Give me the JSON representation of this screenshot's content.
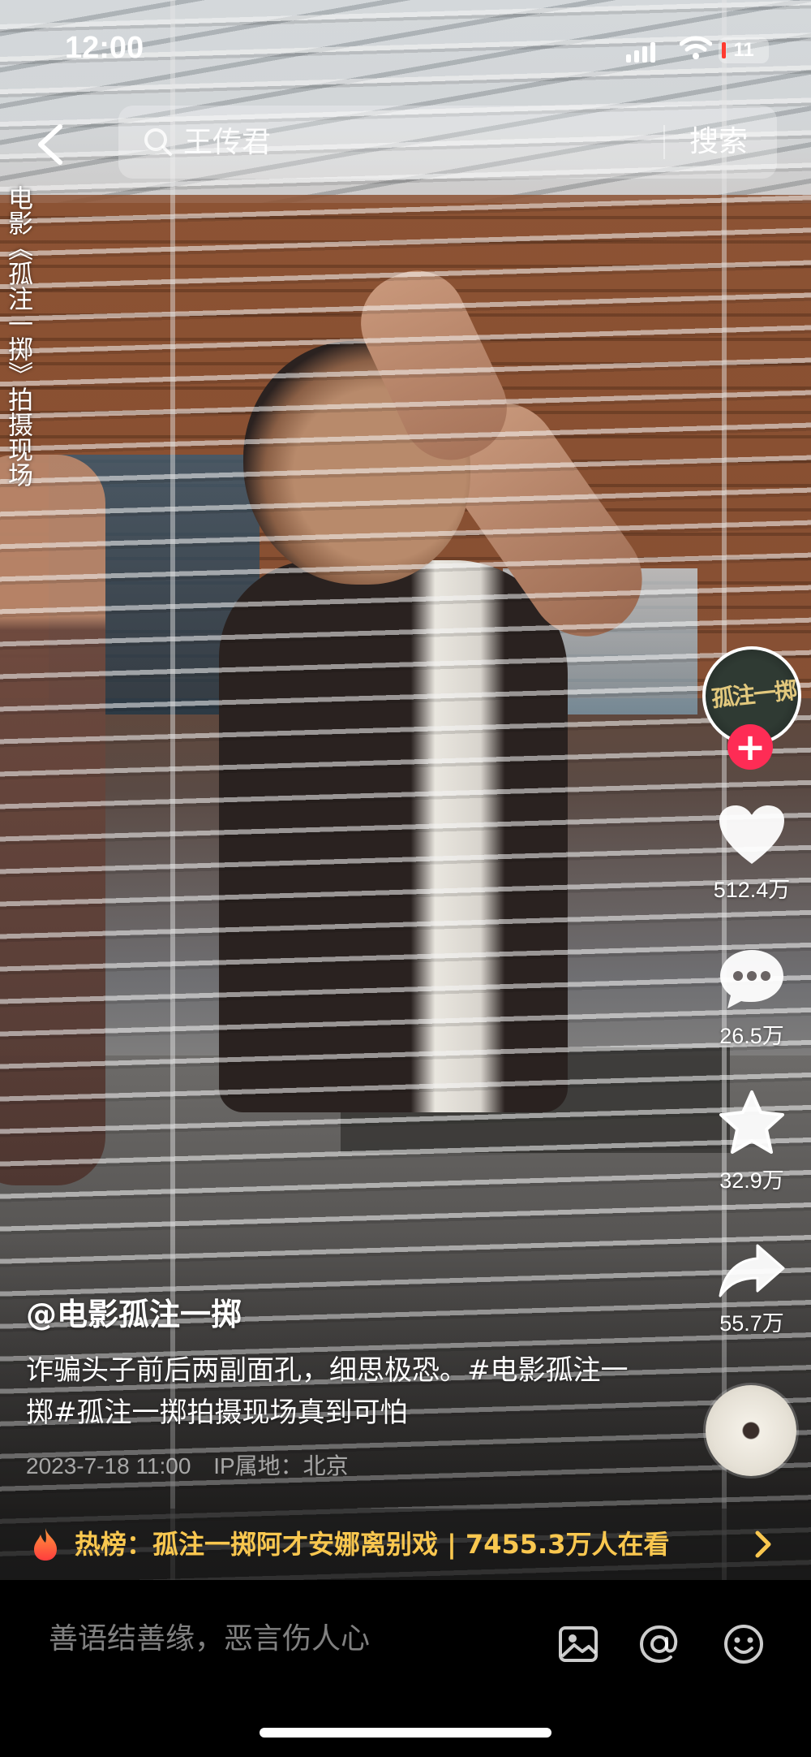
{
  "status_bar": {
    "time": "12:00",
    "battery": "11"
  },
  "search": {
    "placeholder": "王传君",
    "button_label": "搜索"
  },
  "side_label": "电影《孤注一掷》拍摄现场",
  "account": {
    "avatar_text": "孤注一掷",
    "follow_symbol": "+"
  },
  "actions": {
    "like_count": "512.4万",
    "comment_count": "26.5万",
    "favorite_count": "32.9万",
    "share_count": "55.7万"
  },
  "post": {
    "author": "@电影孤注一掷",
    "description": "诈骗头子前后两副面孔，细思极恐。#电影孤注一掷#孤注一掷拍摄现场真到可怕",
    "date": "2023-7-18 11:00",
    "ip_location": "IP属地：北京"
  },
  "hot_banner": {
    "text": "热榜：孤注一掷阿才安娜离别戏 | 7455.3万人在看"
  },
  "comment_bar": {
    "placeholder": "善语结善缘，恶言伤人心"
  },
  "icons": [
    "back-icon",
    "search-icon",
    "heart-icon",
    "comment-icon",
    "star-icon",
    "share-icon",
    "fire-icon",
    "chevron-right-icon",
    "image-icon",
    "at-icon",
    "emoji-icon",
    "signal-icon",
    "wifi-icon"
  ],
  "colors": {
    "follow_red": "#fe2c55",
    "hot_text": "#f9c74f",
    "background": "#000000"
  }
}
